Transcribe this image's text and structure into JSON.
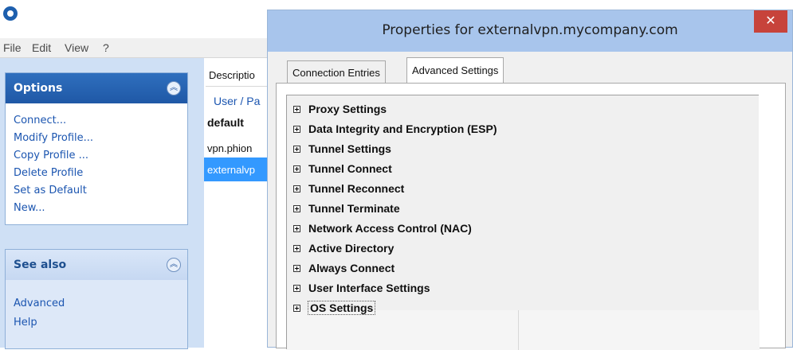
{
  "app": {
    "menu": [
      "File",
      "Edit",
      "View",
      "?"
    ]
  },
  "options_panel": {
    "title": "Options",
    "links": [
      "Connect...",
      "Modify Profile...",
      "Copy Profile ...",
      "Delete Profile",
      "Set as Default",
      "New..."
    ]
  },
  "see_also_panel": {
    "title": "See also",
    "links": [
      "Advanced",
      "Help"
    ]
  },
  "profile_list": {
    "header": "Descriptio",
    "subheader": "User / Pa",
    "rows": [
      "default",
      "vpn.phion",
      "externalvp"
    ],
    "selected_index": 2
  },
  "dialog": {
    "title": "Properties for externalvpn.mycompany.com",
    "close_glyph": "✕",
    "tabs": [
      {
        "label": "Connection Entries",
        "active": false
      },
      {
        "label": "Advanced Settings",
        "active": true
      }
    ],
    "tree_items": [
      "Proxy Settings",
      "Data Integrity and Encryption (ESP)",
      "Tunnel Settings",
      "Tunnel Connect",
      "Tunnel Reconnect",
      "Tunnel Terminate",
      "Network Access Control (NAC)",
      "Active Directory",
      "Always Connect",
      "User Interface Settings",
      "OS Settings"
    ],
    "focused_item_index": 10
  },
  "colors": {
    "dialog_titlebar": "#a8c5ec",
    "close_button": "#c7433b",
    "selection": "#3399ff",
    "left_pane": "#cfe0f5"
  },
  "icons": {
    "app_icon": "gear-circle-icon",
    "collapse": "double-chevron-up-icon",
    "expander": "plus-box-icon"
  }
}
